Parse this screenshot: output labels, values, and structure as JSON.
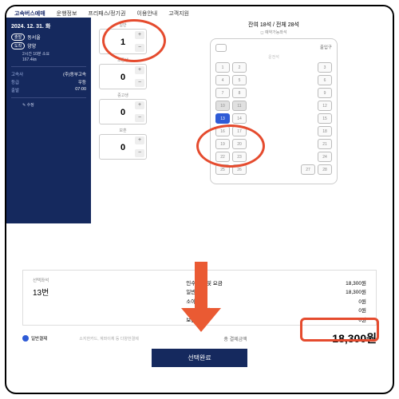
{
  "nav": [
    "고속버스예매",
    "운행정보",
    "프리패스/정기권",
    "이용안내",
    "고객지원"
  ],
  "side": {
    "date": "2024. 12. 31. 화",
    "fromBadge": "출발",
    "from": "동서울",
    "toBadge": "도착",
    "to": "양양",
    "duration": "2시간 10분 소요",
    "distance": "167.4㎞",
    "rows": [
      {
        "l": "고속사",
        "v": "(주)동부고속"
      },
      {
        "l": "등급",
        "v": "우등"
      },
      {
        "l": "출발",
        "v": "07:00"
      }
    ],
    "note": "✎ 수정"
  },
  "counters": [
    {
      "label": "일반",
      "value": "1"
    },
    {
      "label": "초등생",
      "value": "0"
    },
    {
      "label": "중고생",
      "value": "0"
    },
    {
      "label": "보훈",
      "value": "0"
    }
  ],
  "seats": {
    "title": "잔여 18석 / 전체 28석",
    "legend": "◻ 예약가능좌석",
    "driver": "운전석",
    "entrance": "출입구",
    "layout": [
      [
        [
          "1",
          "2"
        ],
        [
          "3"
        ]
      ],
      [
        [
          "4",
          "5"
        ],
        [
          "6"
        ]
      ],
      [
        [
          "7",
          "8"
        ],
        [
          "9"
        ]
      ],
      [
        [
          "10",
          "11"
        ],
        [
          "12"
        ]
      ],
      [
        [
          "13",
          "14"
        ],
        [
          "15"
        ]
      ],
      [
        [
          "16",
          "17"
        ],
        [
          "18"
        ]
      ],
      [
        [
          "19",
          "20"
        ],
        [
          "21"
        ]
      ],
      [
        [
          "22",
          "23"
        ],
        [
          "24"
        ]
      ],
      [
        [
          "25",
          "26"
        ],
        [
          "27",
          "28"
        ]
      ]
    ],
    "selected": [
      "13"
    ],
    "taken": [
      "10",
      "11"
    ]
  },
  "summary": {
    "leftTitle": "선택좌석",
    "seat": "13번",
    "lines": [
      {
        "l": "인수선택 및 요금",
        "v": "18,300원"
      },
      {
        "l": "일반 1명",
        "v": "18,300원"
      },
      {
        "l": "소아할인",
        "v": "0원"
      },
      {
        "l": "중고생할인",
        "v": "0원"
      },
      {
        "l": "보훈 0명",
        "v": "0원"
      }
    ],
    "payLabel": "일반결제",
    "payNote": "소지한카드, 계좌이체 등 다양한결제",
    "totalLabel": "총 결제금액",
    "total": "18,300원",
    "button": "선택완료"
  }
}
